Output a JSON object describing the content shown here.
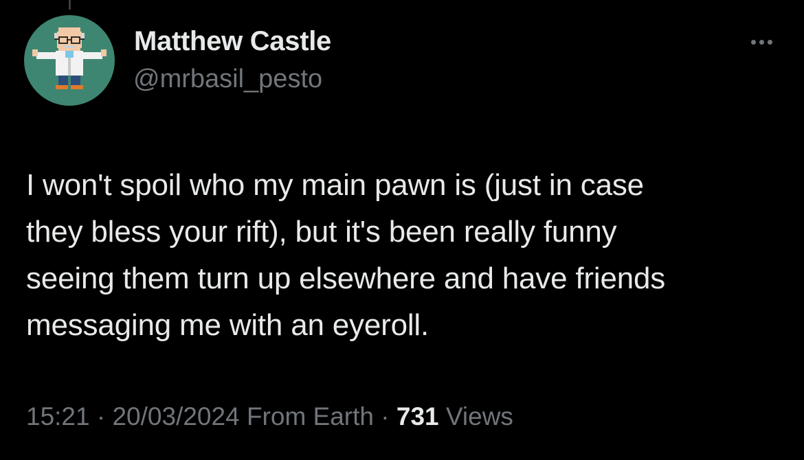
{
  "author": {
    "display_name": "Matthew Castle",
    "handle": "@mrbasil_pesto",
    "avatar_icon": "pixel-art-scientist-avatar-icon"
  },
  "more_icon": "more-options-icon",
  "tweet": {
    "lines": [
      "I won't spoil who my main pawn is (just in case",
      "they bless your rift), but it's been really funny",
      "seeing them turn up elsewhere and have friends",
      "messaging me with an eyeroll."
    ]
  },
  "meta": {
    "time": "15:21",
    "separator": " · ",
    "date": "20/03/2024",
    "source": "From Earth",
    "views_count": "731",
    "views_label": "Views"
  },
  "colors": {
    "background": "#000000",
    "primary_text": "#e7e9ea",
    "secondary_text": "#71767b",
    "avatar_bg": "#3e8672"
  }
}
